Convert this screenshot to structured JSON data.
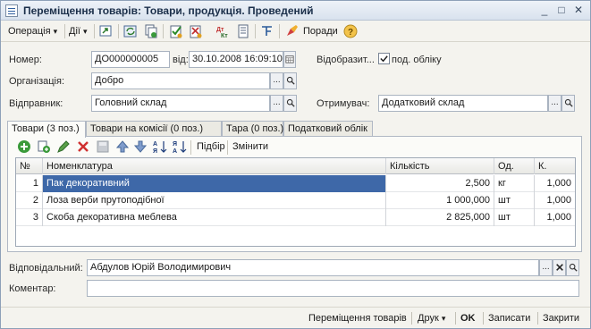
{
  "window": {
    "title": "Переміщення товарів: Товари, продукція. Проведений",
    "min_glyph": "_",
    "max_glyph": "□",
    "close_glyph": "✕"
  },
  "toolbar": {
    "operation_label": "Операція",
    "actions_label": "Дії",
    "advice_label": "Поради",
    "dropdown_glyph": "▾"
  },
  "form": {
    "number_label": "Номер:",
    "number_value": "ДО000000005",
    "date_label": "від:",
    "date_value": "30.10.2008 16:09:10",
    "reflect_label": "Відобразит...",
    "accounting_checkbox_label": "под. обліку",
    "accounting_checked": true,
    "organization_label": "Організація:",
    "organization_value": "Добро",
    "sender_label": "Відправник:",
    "sender_value": "Головний склад",
    "receiver_label": "Отримувач:",
    "receiver_value": "Додатковий склад",
    "ellipsis": "...",
    "responsible_label": "Відповідальний:",
    "responsible_value": "Абдулов Юрій Володимирович",
    "comment_label": "Коментар:",
    "comment_value": ""
  },
  "tabs": [
    {
      "label": "Товари (3 поз.)",
      "active": true
    },
    {
      "label": "Товари на комісії (0 поз.)",
      "active": false
    },
    {
      "label": "Тара (0 поз.)",
      "active": false
    },
    {
      "label": "Податковий облік",
      "active": false
    }
  ],
  "grid_toolbar": {
    "selection_label": "Підбір",
    "change_label": "Змінити"
  },
  "table": {
    "columns": [
      "№",
      "Номенклатура",
      "Кількість",
      "Од.",
      "К."
    ],
    "rows": [
      {
        "n": "1",
        "name": "Пак декоративний",
        "qty": "2,500",
        "unit": "кг",
        "k": "1,000",
        "selected": true
      },
      {
        "n": "2",
        "name": "Лоза верби прутоподібної",
        "qty": "1 000,000",
        "unit": "шт",
        "k": "1,000",
        "selected": false
      },
      {
        "n": "3",
        "name": "Скоба декоративна меблева",
        "qty": "2 825,000",
        "unit": "шт",
        "k": "1,000",
        "selected": false
      }
    ]
  },
  "bottom_bar": {
    "transfer_label": "Переміщення товарів",
    "print_label": "Друк",
    "ok_label": "OK",
    "save_label": "Записати",
    "close_label": "Закрити"
  },
  "colors": {
    "selected_row": "#3e68a8",
    "window_bg": "#f4f3ee",
    "title_text": "#1b2f4a"
  }
}
